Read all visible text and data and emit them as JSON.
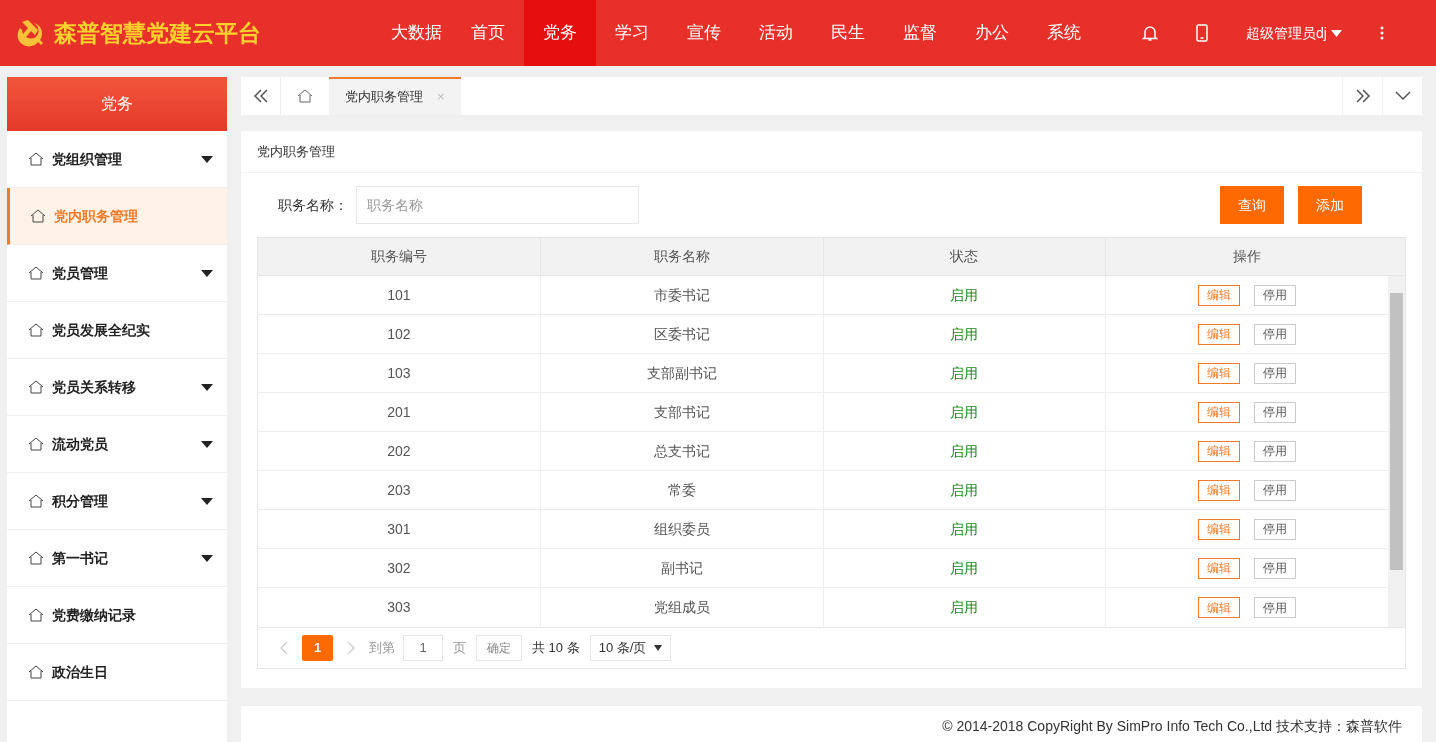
{
  "header": {
    "title": "森普智慧党建云平台",
    "nav": [
      {
        "label": "大数据",
        "selected": false
      },
      {
        "label": "首页",
        "selected": false
      },
      {
        "label": "党务",
        "selected": true
      },
      {
        "label": "学习",
        "selected": false
      },
      {
        "label": "宣传",
        "selected": false
      },
      {
        "label": "活动",
        "selected": false
      },
      {
        "label": "民生",
        "selected": false
      },
      {
        "label": "监督",
        "selected": false
      },
      {
        "label": "办公",
        "selected": false
      },
      {
        "label": "系统",
        "selected": false
      }
    ],
    "user": "超级管理员dj"
  },
  "sidebar": {
    "title": "党务",
    "items": [
      {
        "label": "党组织管理",
        "expandable": true,
        "selected": false
      },
      {
        "label": "党内职务管理",
        "expandable": false,
        "selected": true
      },
      {
        "label": "党员管理",
        "expandable": true,
        "selected": false
      },
      {
        "label": "党员发展全纪实",
        "expandable": false,
        "selected": false
      },
      {
        "label": "党员关系转移",
        "expandable": true,
        "selected": false
      },
      {
        "label": "流动党员",
        "expandable": true,
        "selected": false
      },
      {
        "label": "积分管理",
        "expandable": true,
        "selected": false
      },
      {
        "label": "第一书记",
        "expandable": true,
        "selected": false
      },
      {
        "label": "党费缴纳记录",
        "expandable": false,
        "selected": false
      },
      {
        "label": "政治生日",
        "expandable": false,
        "selected": false
      }
    ]
  },
  "tabs": [
    {
      "label": "党内职务管理",
      "close": "×",
      "selected": true
    }
  ],
  "panel": {
    "title": "党内职务管理",
    "filter_label": "职务名称：",
    "filter": {
      "placeholder": "职务名称"
    },
    "buttons": [
      "查询",
      "添加"
    ]
  },
  "table": {
    "columns": [
      "职务编号",
      "职务名称",
      "状态",
      "操作"
    ],
    "rows": [
      {
        "code": "101",
        "name": "市委书记",
        "status": "启用",
        "actions": [
          "编辑",
          "停用"
        ]
      },
      {
        "code": "102",
        "name": "区委书记",
        "status": "启用",
        "actions": [
          "编辑",
          "停用"
        ]
      },
      {
        "code": "103",
        "name": "支部副书记",
        "status": "启用",
        "actions": [
          "编辑",
          "停用"
        ]
      },
      {
        "code": "201",
        "name": "支部书记",
        "status": "启用",
        "actions": [
          "编辑",
          "停用"
        ]
      },
      {
        "code": "202",
        "name": "总支书记",
        "status": "启用",
        "actions": [
          "编辑",
          "停用"
        ]
      },
      {
        "code": "203",
        "name": "常委",
        "status": "启用",
        "actions": [
          "编辑",
          "停用"
        ]
      },
      {
        "code": "301",
        "name": "组织委员",
        "status": "启用",
        "actions": [
          "编辑",
          "停用"
        ]
      },
      {
        "code": "302",
        "name": "副书记",
        "status": "启用",
        "actions": [
          "编辑",
          "停用"
        ]
      },
      {
        "code": "303",
        "name": "党组成员",
        "status": "启用",
        "actions": [
          "编辑",
          "停用"
        ]
      }
    ]
  },
  "pagination": {
    "pages": [
      {
        "label": "1",
        "selected": true
      }
    ],
    "goto_label": "到第",
    "goto_value": "1",
    "page_unit": "页",
    "confirm": "确定",
    "total": "共 10 条",
    "page_size": "10 条/页"
  },
  "footer": "© 2014-2018 CopyRight By SimPro Info Tech Co.,Ltd 技术支持：森普软件"
}
